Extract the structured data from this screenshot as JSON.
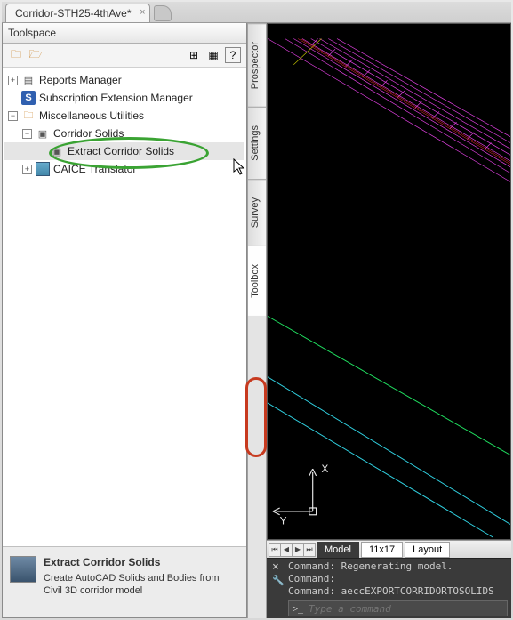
{
  "doc_tab": {
    "title": "Corridor-STH25-4thAve*"
  },
  "toolspace": {
    "title": "Toolspace",
    "tree": {
      "reports": "Reports Manager",
      "subscription": "Subscription Extension Manager",
      "misc": "Miscellaneous Utilities",
      "corridor_solids": "Corridor Solids",
      "extract": "Extract Corridor Solids",
      "caice": "CAICE   Translator"
    },
    "footer": {
      "title": "Extract Corridor Solids",
      "desc": "Create AutoCAD Solids and Bodies from Civil 3D corridor model"
    }
  },
  "vtabs": {
    "prospector": "Prospector",
    "settings": "Settings",
    "survey": "Survey",
    "toolbox": "Toolbox"
  },
  "layout_tabs": {
    "model": "Model",
    "t11x17": "11x17",
    "layout": "Layout"
  },
  "command": {
    "line1": "Command:  Regenerating model.",
    "line2": "Command:",
    "line3": "Command:  aeccEXPORTCORRIDORTOSOLIDS",
    "placeholder": "Type a command"
  },
  "ucs": {
    "x": "X",
    "y": "Y"
  }
}
